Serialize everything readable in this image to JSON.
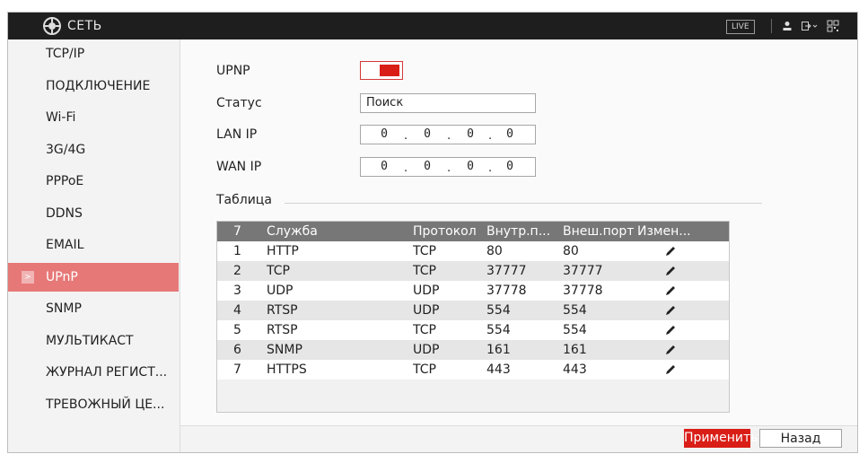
{
  "header": {
    "title": "СЕТЬ",
    "live_label": "LIVE",
    "icons": [
      "network-logo-icon",
      "user-icon",
      "logout-icon",
      "qr-code-icon"
    ]
  },
  "sidebar": {
    "items": [
      {
        "label": "TCP/IP",
        "active": false
      },
      {
        "label": "ПОДКЛЮЧЕНИЕ",
        "active": false
      },
      {
        "label": "Wi-Fi",
        "active": false
      },
      {
        "label": "3G/4G",
        "active": false
      },
      {
        "label": "PPPoE",
        "active": false
      },
      {
        "label": "DDNS",
        "active": false
      },
      {
        "label": "EMAIL",
        "active": false
      },
      {
        "label": "UPnP",
        "active": true
      },
      {
        "label": "SNMP",
        "active": false
      },
      {
        "label": "МУЛЬТИКАСТ",
        "active": false
      },
      {
        "label": "ЖУРНАЛ РЕГИСТ...",
        "active": false
      },
      {
        "label": "ТРЕВОЖНЫЙ ЦЕ...",
        "active": false
      }
    ],
    "active_arrow": ">"
  },
  "form": {
    "upnp_label": "UPNP",
    "upnp_enabled": true,
    "status_label": "Статус",
    "status_value": "Поиск",
    "lan_ip_label": "LAN IP",
    "lan_ip": [
      "0",
      "0",
      "0",
      "0"
    ],
    "wan_ip_label": "WAN IP",
    "wan_ip": [
      "0",
      "0",
      "0",
      "0"
    ],
    "ip_separator": "."
  },
  "table": {
    "section_label": "Таблица",
    "headers": [
      "7",
      "Служба",
      "Протокол",
      "Внутр.п...",
      "Внеш.порт",
      "Измен..."
    ],
    "rows": [
      {
        "num": "1",
        "service": "HTTP",
        "protocol": "TCP",
        "internal_port": "80",
        "external_port": "80"
      },
      {
        "num": "2",
        "service": "TCP",
        "protocol": "TCP",
        "internal_port": "37777",
        "external_port": "37777"
      },
      {
        "num": "3",
        "service": "UDP",
        "protocol": "UDP",
        "internal_port": "37778",
        "external_port": "37778"
      },
      {
        "num": "4",
        "service": "RTSP",
        "protocol": "UDP",
        "internal_port": "554",
        "external_port": "554"
      },
      {
        "num": "5",
        "service": "RTSP",
        "protocol": "TCP",
        "internal_port": "554",
        "external_port": "554"
      },
      {
        "num": "6",
        "service": "SNMP",
        "protocol": "UDP",
        "internal_port": "161",
        "external_port": "161"
      },
      {
        "num": "7",
        "service": "HTTPS",
        "protocol": "TCP",
        "internal_port": "443",
        "external_port": "443"
      }
    ],
    "edit_icon": "pencil-icon"
  },
  "footer": {
    "apply_label": "Применить",
    "back_label": "Назад"
  },
  "colors": {
    "accent": "#d91e18",
    "active_item": "#e77878",
    "topbar": "#1e1e1e",
    "table_header": "#777777"
  }
}
